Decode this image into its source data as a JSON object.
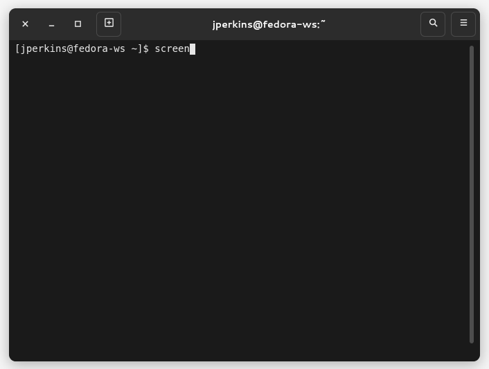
{
  "window": {
    "title": "jperkins@fedora-ws:~"
  },
  "terminal": {
    "prompt": "[jperkins@fedora-ws ~]$ ",
    "command": "screen"
  },
  "icons": {
    "close": "close-icon",
    "minimize": "minimize-icon",
    "maximize": "maximize-icon",
    "new_tab": "new-tab-icon",
    "search": "search-icon",
    "menu": "hamburger-menu-icon"
  }
}
